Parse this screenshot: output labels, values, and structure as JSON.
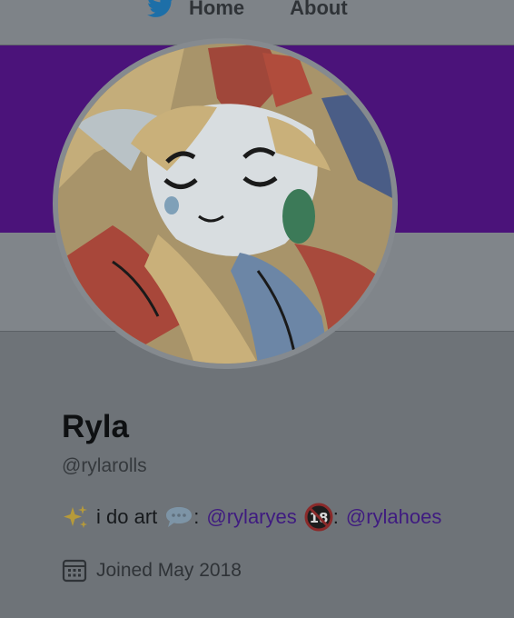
{
  "nav": {
    "home_label": "Home",
    "about_label": "About",
    "brand_icon": "twitter-bird-icon"
  },
  "colors": {
    "banner": "#4b137a",
    "link": "#3f1b80",
    "twitter_blue": "#1d6fa8"
  },
  "profile": {
    "display_name": "Ryla",
    "handle": "@rylarolls",
    "bio": {
      "sparkles_icon": "sparkles-icon",
      "text": "i do art",
      "speech_icon": "speech-bubble-icon",
      "sep1": ":",
      "link1": "@rylaryes",
      "no18_icon": "no-under-18-icon",
      "sep2": ":",
      "link2": "@rylahoes"
    },
    "joined": "Joined May 2018",
    "joined_icon": "calendar-icon"
  }
}
